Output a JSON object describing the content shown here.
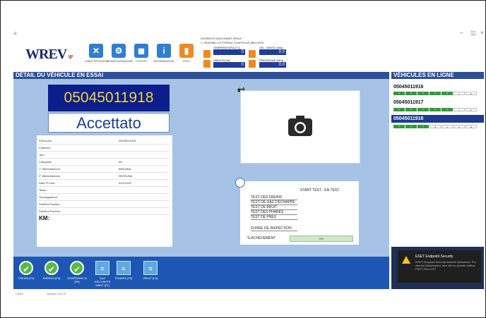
{
  "app": {
    "logo": "WREV",
    "logo_suffix": "SP",
    "menu_glyph": "≡",
    "minimize": "–",
    "maximize": "◫",
    "close": "×"
  },
  "toolbar": [
    {
      "label": "LINEE REVISIONE",
      "icon": "tools-icon",
      "glyph": "✕",
      "color": "#2f7fd1"
    },
    {
      "label": "CONFIGURAZIONE",
      "icon": "gear-icon",
      "glyph": "⚙",
      "color": "#2f7fd1"
    },
    {
      "label": "UTENTE",
      "icon": "user-icon",
      "glyph": "◼",
      "color": "#2f7fd1"
    },
    {
      "label": "INFORMAZIONI",
      "icon": "info-icon",
      "glyph": "i",
      "color": "#2f7fd1"
    },
    {
      "label": "ESCI",
      "icon": "exit-icon",
      "glyph": "▮",
      "color": "#f08a1e"
    }
  ],
  "sensors": {
    "header1": "DOVRESTI DISCONNETTERLE",
    "header2": "☐ SENSIBILI LETTERALI STATISCHE ABILITATE",
    "temp_label": "TEMPERATURA [°C]",
    "temp_value": "0",
    "humidity_label": "UMIDITÀ [%]",
    "humidity_value": "0",
    "wind_label": "VEL. VENTO [m/s]",
    "wind_value": "0.0",
    "pressure_label": "PRESSIONE [hPa]",
    "pressure_value": "0.0"
  },
  "left_header": "DÉTAIL DU VÉHICULE EN ESSAI",
  "right_header": "VÉHICULES EN LIGNE",
  "vehicle": {
    "plate": "05045011918",
    "status": "Accettato",
    "fields": [
      {
        "k": "Protocollo:",
        "v": "05045011918"
      },
      {
        "k": "Fabbrica:",
        "v": ""
      },
      {
        "k": "Tipo:",
        "v": ""
      },
      {
        "k": "Categoria:",
        "v": "M1"
      },
      {
        "k": "1° Alimentazione:",
        "v": "BENZINA"
      },
      {
        "k": "2° Alimentazione:",
        "v": "NESSUNA"
      },
      {
        "k": "Data 1ª Imm.:",
        "v": "01012020"
      },
      {
        "k": "Telaio:",
        "v": ""
      },
      {
        "k": "Omologazione:",
        "v": ""
      },
      {
        "k": "Direttiva Scarico:",
        "v": ""
      },
      {
        "k": "Direttiva Rumore:",
        "v": ""
      }
    ],
    "km_label": "KM:"
  },
  "test": {
    "start": "START TEST - EN TEST",
    "lines": [
      "TEST DES FREINS",
      "TEST DE GAZ D'ÉCHAPPE",
      "TEST DE BRUIT",
      "TEST DES PHARES",
      "TEST DE PNEU"
    ],
    "duration": "DURÉE DE INSPECTION",
    "percent_label": "% ACHÈVEMENT",
    "percent_value": "0%",
    "progress": 0
  },
  "online": [
    {
      "plate": "05045011916",
      "cells": [
        "●",
        "●",
        "●",
        "●",
        "●",
        "2",
        "►"
      ]
    },
    {
      "plate": "05045011917",
      "cells": [
        "●",
        "●",
        "●",
        "●",
        "●",
        "2",
        "►"
      ]
    },
    {
      "plate": "05045011918",
      "cells": [
        "●",
        "●",
        "●",
        "G",
        "F",
        "A",
        "E"
      ]
    }
  ],
  "functions": [
    {
      "label": "FREINS [F1]",
      "type": "ok"
    },
    {
      "label": "RIPRISO [F8]",
      "type": "ok"
    },
    {
      "label": "SOSPENSIO N [F9]",
      "type": "ok"
    },
    {
      "label": "GAZ D'ÉCHAPPE MENT [F2]",
      "type": "sq"
    },
    {
      "label": "PHARES [F3]",
      "type": "sq"
    },
    {
      "label": "BRUIT [F4]",
      "type": "sq"
    }
  ],
  "notification": {
    "title": "ESET Endpoint Security",
    "body": "ESET Endpoint Security richiede attenzione. Per ulteriori informazioni, fare clic su questa notifica.",
    "source": "ESET Peer-CST"
  },
  "footer": {
    "left": "LAVIS",
    "version": "Version 2.0.0.5"
  }
}
